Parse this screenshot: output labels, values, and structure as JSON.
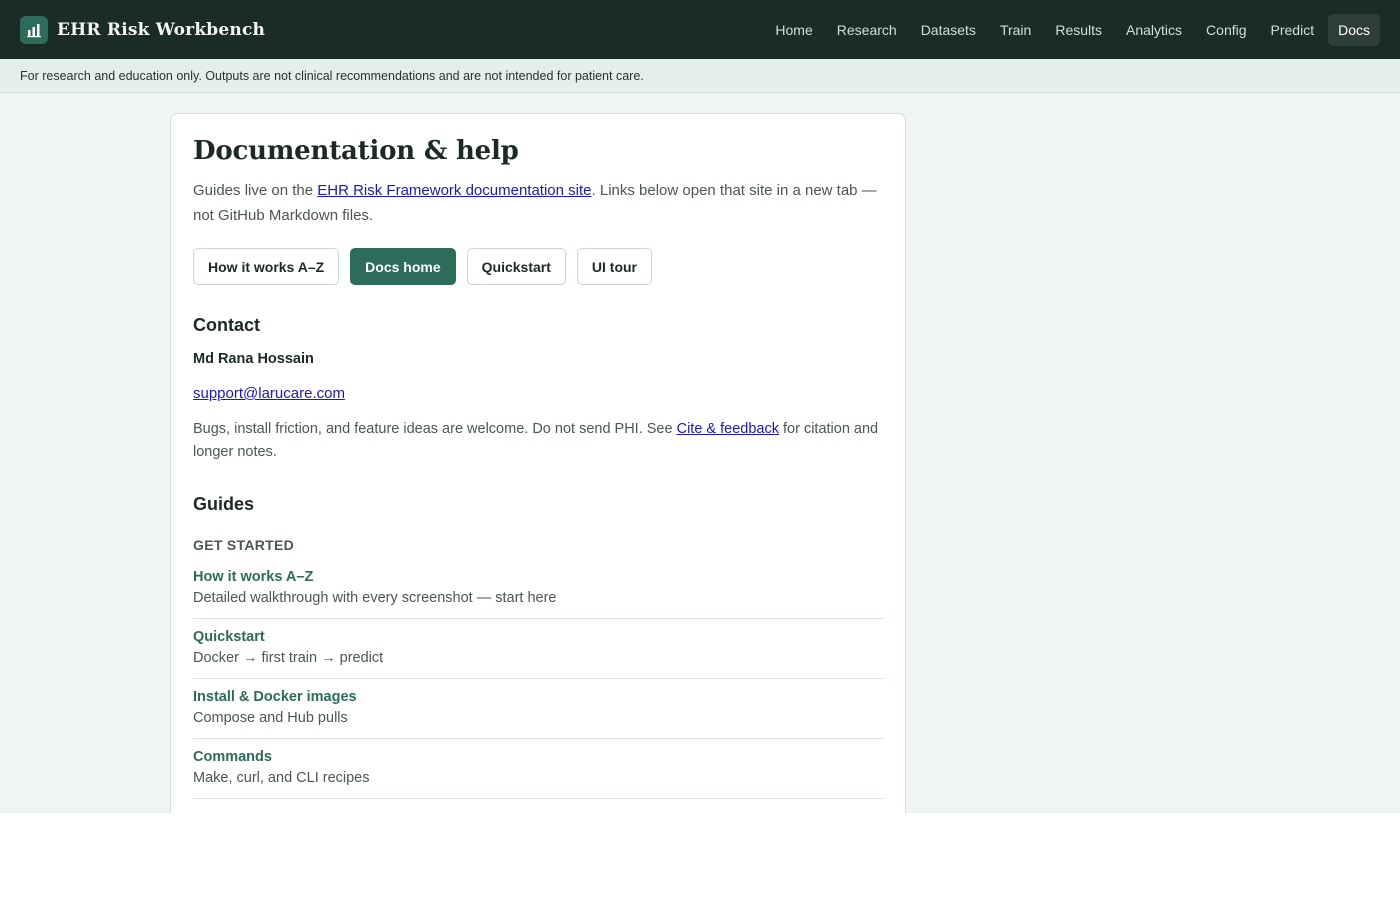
{
  "app": {
    "title": "EHR Risk Workbench",
    "logo_icon": "bar-chart-icon"
  },
  "nav": {
    "items": [
      {
        "label": "Home",
        "active": false
      },
      {
        "label": "Research",
        "active": false
      },
      {
        "label": "Datasets",
        "active": false
      },
      {
        "label": "Train",
        "active": false
      },
      {
        "label": "Results",
        "active": false
      },
      {
        "label": "Analytics",
        "active": false
      },
      {
        "label": "Config",
        "active": false
      },
      {
        "label": "Predict",
        "active": false
      },
      {
        "label": "Docs",
        "active": true
      }
    ]
  },
  "disclaimer": "For research and education only. Outputs are not clinical recommendations and are not intended for patient care.",
  "page": {
    "title": "Documentation & help",
    "intro_before": "Guides live on the ",
    "intro_link": "EHR Risk Framework documentation site",
    "intro_after": ". Links below open that site in a new tab — not GitHub Markdown files."
  },
  "buttons": [
    {
      "label": "How it works A–Z",
      "primary": false
    },
    {
      "label": "Docs home",
      "primary": true
    },
    {
      "label": "Quickstart",
      "primary": false
    },
    {
      "label": "UI tour",
      "primary": false
    }
  ],
  "contact": {
    "heading": "Contact",
    "name": "Md Rana Hossain",
    "email": "support@larucare.com",
    "note_before": "Bugs, install friction, and feature ideas are welcome. Do not send PHI. See ",
    "note_link": "Cite & feedback",
    "note_after": " for citation and longer notes."
  },
  "guides": {
    "heading": "Guides",
    "group_label": "GET STARTED",
    "items": [
      {
        "title": "How it works A–Z",
        "desc": "Detailed walkthrough with every screenshot — start here"
      },
      {
        "title": "Quickstart",
        "desc": "Docker → first train → predict"
      },
      {
        "title": "Install & Docker images",
        "desc": "Compose and Hub pulls"
      },
      {
        "title": "Commands",
        "desc": "Make, curl, and CLI recipes"
      }
    ]
  },
  "colors": {
    "topbar": "#1b2b26",
    "accent": "#2d6b5a",
    "page_bg": "#eef5f2",
    "link": "#1a17c9"
  }
}
